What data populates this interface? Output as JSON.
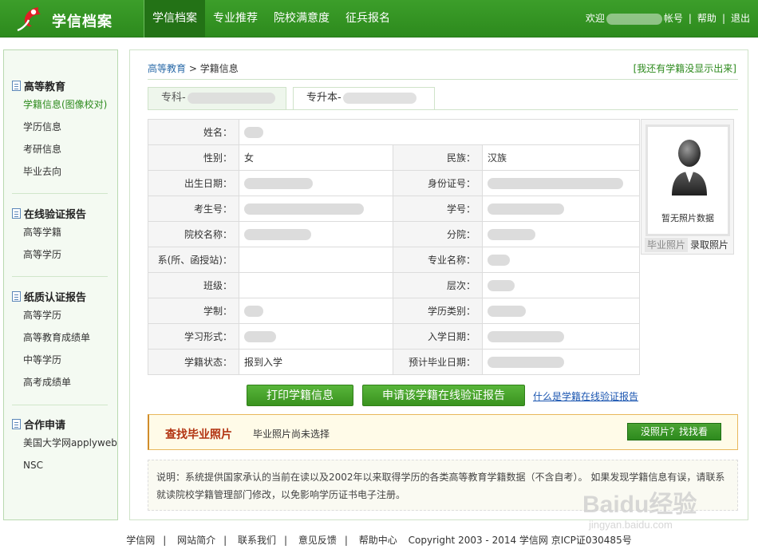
{
  "header": {
    "brand": "学信档案",
    "nav": [
      "学信档案",
      "专业推荐",
      "院校满意度",
      "征兵报名"
    ],
    "welcome": "欢迎",
    "account_suffix": "帐号",
    "help": "帮助",
    "logout": "退出"
  },
  "sidebar": {
    "groups": [
      {
        "title": "高等教育",
        "items": [
          "学籍信息(图像校对)",
          "学历信息",
          "考研信息",
          "毕业去向"
        ]
      },
      {
        "title": "在线验证报告",
        "items": [
          "高等学籍",
          "高等学历"
        ]
      },
      {
        "title": "纸质认证报告",
        "items": [
          "高等学历",
          "高等教育成绩单",
          "中等学历",
          "高考成绩单"
        ]
      },
      {
        "title": "合作申请",
        "items": [
          "美国大学网applyweb",
          "NSC"
        ]
      }
    ]
  },
  "breadcrumb": {
    "level1": "高等教育",
    "sep": ">",
    "level2": "学籍信息"
  },
  "not_shown_link": "[我还有学籍没显示出来]",
  "tabs": [
    "专科-",
    "专升本-"
  ],
  "info": {
    "name_label": "姓名：",
    "gender_label": "性别：",
    "gender": "女",
    "ethnicity_label": "民族：",
    "ethnicity": "汉族",
    "birth_label": "出生日期：",
    "id_label": "身份证号：",
    "exam_no_label": "考生号：",
    "student_no_label": "学号：",
    "school_label": "院校名称：",
    "branch_label": "分院：",
    "dept_label": "系(所、函授站)：",
    "major_label": "专业名称：",
    "class_label": "班级：",
    "level_label": "层次：",
    "duration_label": "学制：",
    "category_label": "学历类别：",
    "form_label": "学习形式：",
    "enroll_label": "入学日期：",
    "status_label": "学籍状态：",
    "status": "报到入学",
    "grad_label": "预计毕业日期："
  },
  "photo": {
    "no_photo": "暂无照片数据",
    "tab_grad": "毕业照片",
    "tab_enroll": "录取照片"
  },
  "actions": {
    "print": "打印学籍信息",
    "apply_report": "申请该学籍在线验证报告",
    "what_is": "什么是学籍在线验证报告"
  },
  "find_photo": {
    "title": "查找毕业照片",
    "status": "毕业照片尚未选择",
    "button": "没照片？找找看"
  },
  "note": "说明：系统提供国家承认的当前在读以及2002年以来取得学历的各类高等教育学籍数据（不含自考）。 如果发现学籍信息有误，请联系就读院校学籍管理部门修改，以免影响学历证书电子注册。",
  "footer": {
    "links": [
      "学信网",
      "网站简介",
      "联系我们",
      "意见反馈",
      "帮助中心"
    ],
    "copyright": "Copyright 2003 - 2014  学信网  京ICP证030485号"
  },
  "watermark": {
    "brand": "Baidu经验",
    "url": "jingyan.baidu.com"
  },
  "colors": {
    "header_green": "#3c9e2a",
    "accent_red": "#e02020",
    "link_blue": "#1a55b0"
  }
}
